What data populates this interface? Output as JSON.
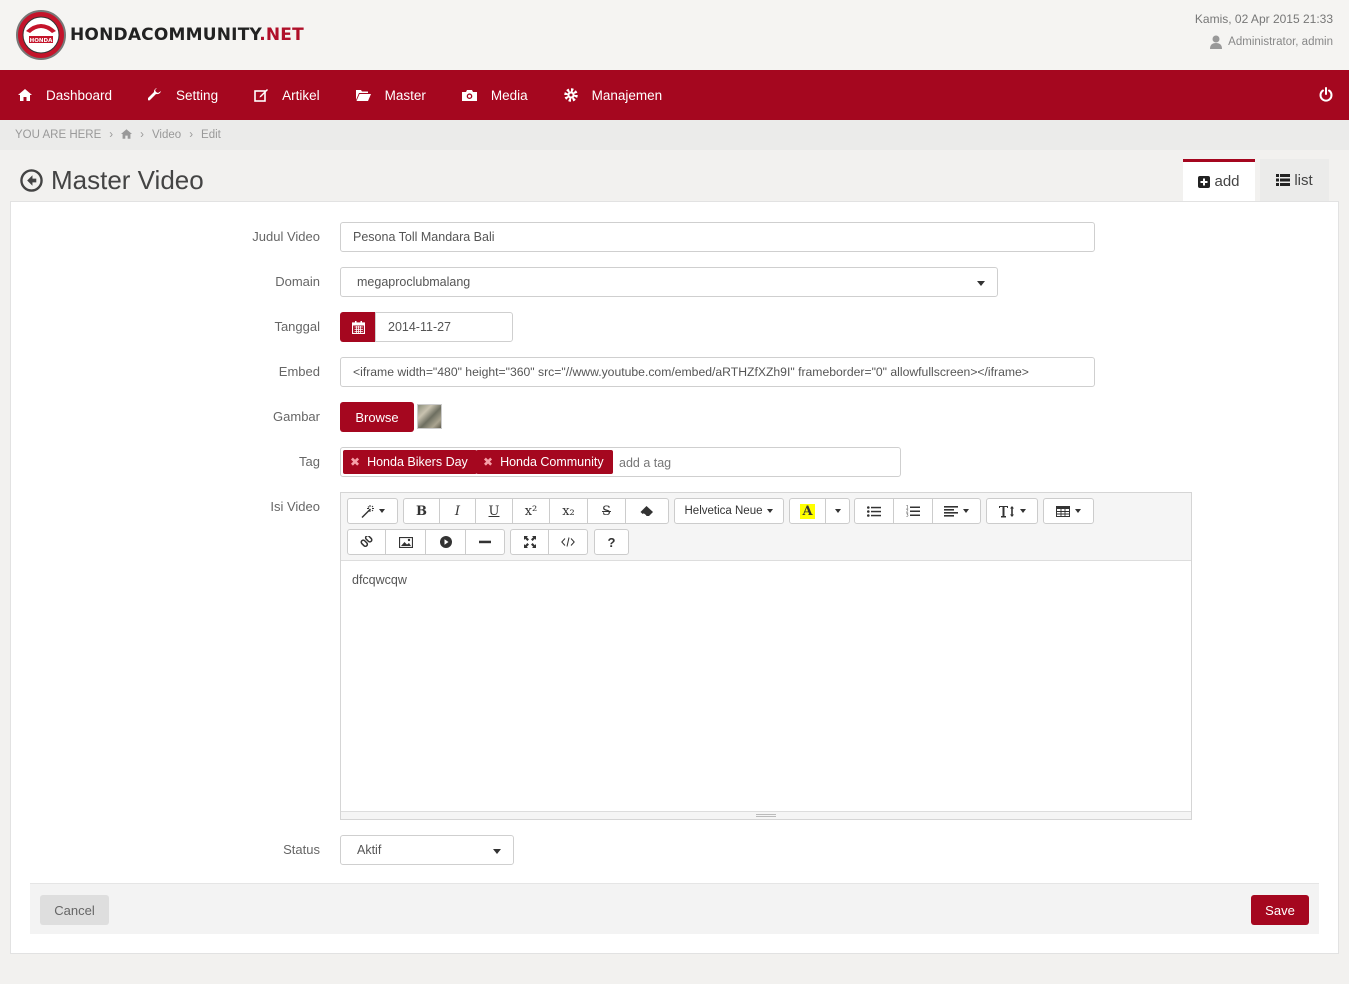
{
  "brand": {
    "name_main": "HONDACOMMUNITY",
    "name_suffix": ".NET",
    "badge_text": "HONDA",
    "accent_color": "#a5071f"
  },
  "header": {
    "date": "Kamis, 02 Apr 2015 21:33",
    "user": "Administrator, admin",
    "user_icon": "user-icon"
  },
  "nav": {
    "items": [
      {
        "label": "Dashboard",
        "icon": "home-icon"
      },
      {
        "label": "Setting",
        "icon": "wrench-icon"
      },
      {
        "label": "Artikel",
        "icon": "edit-icon"
      },
      {
        "label": "Master",
        "icon": "folder-open-icon"
      },
      {
        "label": "Media",
        "icon": "camera-icon"
      },
      {
        "label": "Manajemen",
        "icon": "gear-icon"
      }
    ],
    "power_icon": "power-icon"
  },
  "breadcrumb": {
    "prefix": "YOU ARE HERE",
    "home_icon": "home-icon",
    "items": [
      "Video",
      "Edit"
    ]
  },
  "page": {
    "title": "Master Video",
    "tabs": [
      {
        "label": "add",
        "icon": "plus-square-icon",
        "active": true
      },
      {
        "label": "list",
        "icon": "list-icon",
        "active": false
      }
    ]
  },
  "form": {
    "judul": {
      "label": "Judul Video",
      "value": "Pesona Toll Mandara Bali"
    },
    "domain": {
      "label": "Domain",
      "value": "megaproclubmalang"
    },
    "tanggal": {
      "label": "Tanggal",
      "value": "2014-11-27"
    },
    "embed": {
      "label": "Embed",
      "value": "<iframe width=\"480\" height=\"360\" src=\"//www.youtube.com/embed/aRTHZfXZh9I\" frameborder=\"0\" allowfullscreen></iframe>"
    },
    "gambar": {
      "label": "Gambar",
      "browse_label": "Browse"
    },
    "tag": {
      "label": "Tag",
      "tags": [
        "Honda Bikers Day",
        "Honda Community"
      ],
      "placeholder": "add a tag"
    },
    "isi": {
      "label": "Isi Video",
      "content": "dfcqwcqw",
      "font_name": "Helvetica Neue"
    },
    "status": {
      "label": "Status",
      "value": "Aktif"
    }
  },
  "actions": {
    "cancel": "Cancel",
    "save": "Save"
  }
}
